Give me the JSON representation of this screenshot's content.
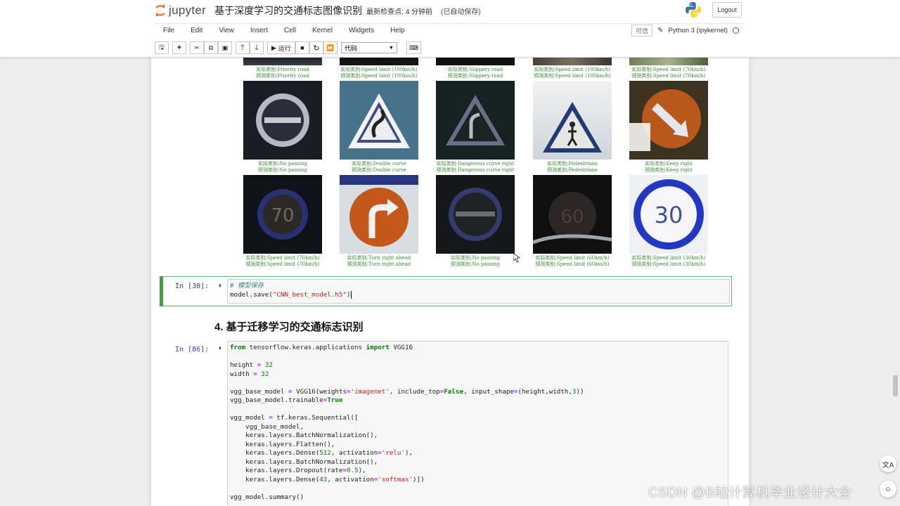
{
  "header": {
    "logo_text": "jupyter",
    "notebook_name": "基于深度学习的交通标志图像识别",
    "checkpoint": "最新检查点: 4 分钟前",
    "autosave": "(已自动保存)",
    "logout": "Logout"
  },
  "menu": [
    "File",
    "Edit",
    "View",
    "Insert",
    "Cell",
    "Kernel",
    "Widgets",
    "Help"
  ],
  "kernel": {
    "trusted": "可信",
    "name": "Python 3 (ipykernel)"
  },
  "toolbar": {
    "run_label": "运行",
    "cell_type": "代码"
  },
  "signs": [
    {
      "actual": "实际类别:Priority road",
      "predicted": "预测类别:Priority road"
    },
    {
      "actual": "实际类别:Speed limit (100km/h)",
      "predicted": "预测类别:Speed limit (100km/h)"
    },
    {
      "actual": "实际类别:Slippery road",
      "predicted": "预测类别:Slippery road"
    },
    {
      "actual": "实际类别:Speed limit (100km/h)",
      "predicted": "预测类别:Speed limit (100km/h)"
    },
    {
      "actual": "实际类别:Speed limit (70km/h)",
      "predicted": "预测类别:Speed limit (70km/h)"
    },
    {
      "actual": "实际类别:No passing",
      "predicted": "预测类别:No passing"
    },
    {
      "actual": "实际类别:Double curve",
      "predicted": "预测类别:Double curve"
    },
    {
      "actual": "实际类别:Dangerous curve right",
      "predicted": "预测类别:Dangerous curve right"
    },
    {
      "actual": "实际类别:Pedestrians",
      "predicted": "预测类别:Pedestrians"
    },
    {
      "actual": "实际类别:Keep right",
      "predicted": "预测类别:Keep right"
    },
    {
      "actual": "实际类别:Speed limit (70km/h)",
      "predicted": "预测类别:Speed limit (70km/h)"
    },
    {
      "actual": "实际类别:Turn right ahead",
      "predicted": "预测类别:Turn right ahead"
    },
    {
      "actual": "实际类别:No passing",
      "predicted": "预测类别:No passing"
    },
    {
      "actual": "实际类别:Speed limit (60km/h)",
      "predicted": "预测类别:Speed limit (60km/h)"
    },
    {
      "actual": "实际类别:Speed limit (30km/h)",
      "predicted": "预测类别:Speed limit (30km/h)"
    }
  ],
  "cell30": {
    "prompt": "In [30]:",
    "comment": "# 模型保存",
    "line2_prefix": "model.save(",
    "line2_string": "\"CNN_best_model.h5\"",
    "line2_suffix": ")"
  },
  "section_heading": "4. 基于迁移学习的交通标志识别",
  "cell86": {
    "prompt": "In [86]:"
  },
  "watermark": "CSDN @B站计算机毕业设计大全"
}
